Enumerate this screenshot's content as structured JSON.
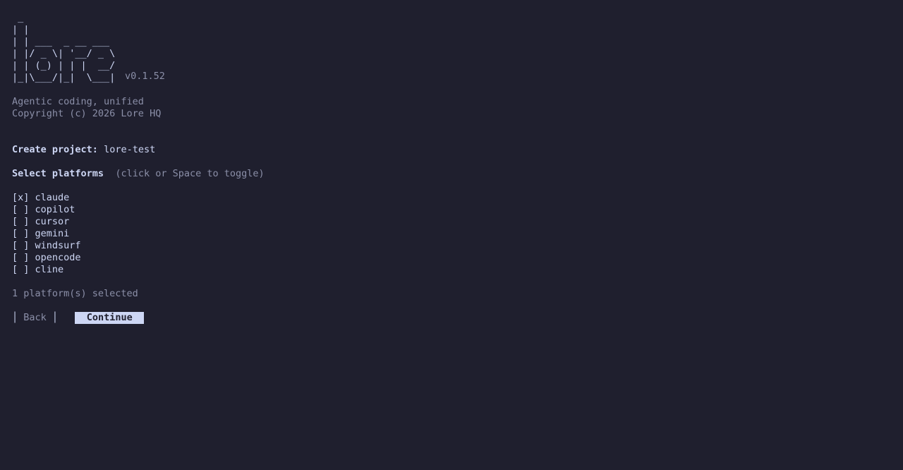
{
  "logo_ascii": " _\n| |\n| | ___  _ __ ___\n| |/ _ \\| '__/ _ \\\n| | (_) | | |  __/\n|_|\\___/|_|  \\___|",
  "version": "v0.1.52",
  "tagline": "Agentic coding, unified",
  "copyright": "Copyright (c) 2026 Lore HQ",
  "create_project": {
    "label": "Create project:",
    "value": "lore-test"
  },
  "platforms": {
    "heading": "Select platforms",
    "hint": "(click or Space to toggle)",
    "items": [
      {
        "checkbox": "[x]",
        "name": "claude"
      },
      {
        "checkbox": "[ ]",
        "name": "copilot"
      },
      {
        "checkbox": "[ ]",
        "name": "cursor"
      },
      {
        "checkbox": "[ ]",
        "name": "gemini"
      },
      {
        "checkbox": "[ ]",
        "name": "windsurf"
      },
      {
        "checkbox": "[ ]",
        "name": "opencode"
      },
      {
        "checkbox": "[ ]",
        "name": "cline"
      }
    ],
    "status": "1 platform(s) selected"
  },
  "buttons": {
    "back_label": "Back",
    "continue_label": "Continue"
  }
}
